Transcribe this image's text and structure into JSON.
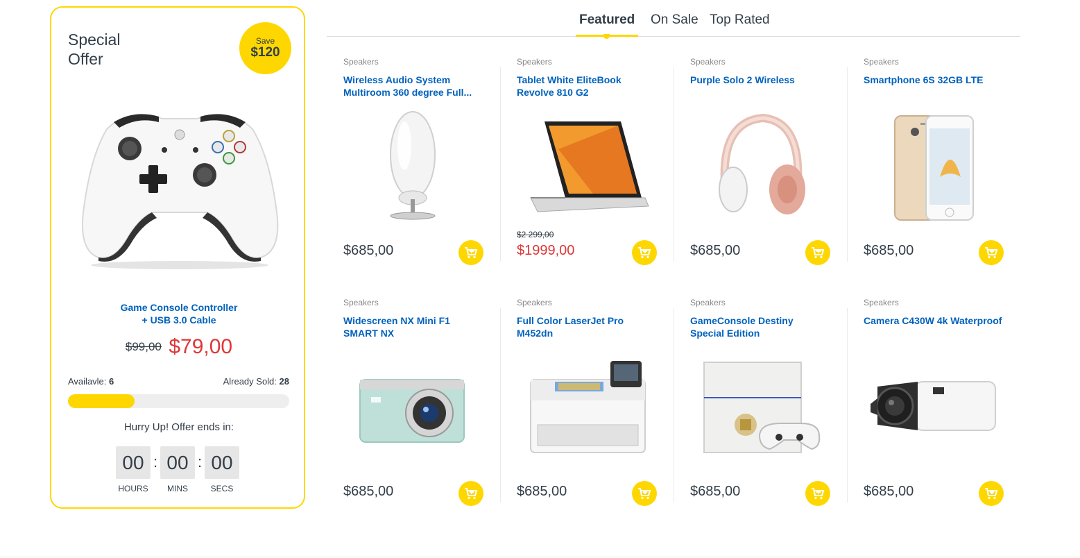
{
  "special_offer": {
    "title_line1": "Special",
    "title_line2": "Offer",
    "save_label": "Save",
    "save_amount": "$120",
    "image_icon": "game-controller-image",
    "name_line1": "Game Console Controller",
    "name_line2": "+ USB 3.0 Cable",
    "old_price": "$99,00",
    "new_price": "$79,00",
    "available_label": "Availavle:",
    "available_value": "6",
    "sold_label": "Already Sold:",
    "sold_value": "28",
    "sold_fraction": 0.3,
    "hurry_text": "Hurry Up! Offer ends in:",
    "countdown": {
      "hours": "00",
      "mins": "00",
      "secs": "00",
      "hours_label": "HOURS",
      "mins_label": "MINS",
      "secs_label": "SECS",
      "separator": ":"
    }
  },
  "tabs": [
    {
      "label": "Featured",
      "active": true
    },
    {
      "label": "On Sale",
      "active": false
    },
    {
      "label": "Top Rated",
      "active": false
    }
  ],
  "products": [
    {
      "category": "Speakers",
      "name": "Wireless Audio System Multiroom 360 degree Full...",
      "price": "$685,00",
      "old_price": "",
      "image_icon": "speaker-image"
    },
    {
      "category": "Speakers",
      "name": "Tablet White EliteBook Revolve 810 G2",
      "price": "$1999,00",
      "old_price": "$2 299,00",
      "image_icon": "laptop-image"
    },
    {
      "category": "Speakers",
      "name": "Purple Solo 2 Wireless",
      "price": "$685,00",
      "old_price": "",
      "image_icon": "headphones-image"
    },
    {
      "category": "Speakers",
      "name": "Smartphone 6S 32GB LTE",
      "price": "$685,00",
      "old_price": "",
      "image_icon": "smartphone-image"
    },
    {
      "category": "Speakers",
      "name": "Widescreen NX Mini F1 SMART NX",
      "price": "$685,00",
      "old_price": "",
      "image_icon": "camera-image"
    },
    {
      "category": "Speakers",
      "name": "Full Color LaserJet Pro M452dn",
      "price": "$685,00",
      "old_price": "",
      "image_icon": "printer-image"
    },
    {
      "category": "Speakers",
      "name": "GameConsole Destiny Special Edition",
      "price": "$685,00",
      "old_price": "",
      "image_icon": "game-console-image"
    },
    {
      "category": "Speakers",
      "name": "Camera C430W 4k Waterproof",
      "price": "$685,00",
      "old_price": "",
      "image_icon": "camcorder-image"
    }
  ],
  "colors": {
    "accent": "#fed700",
    "link": "#0062bd",
    "sale": "#df3737",
    "text": "#333e48"
  }
}
